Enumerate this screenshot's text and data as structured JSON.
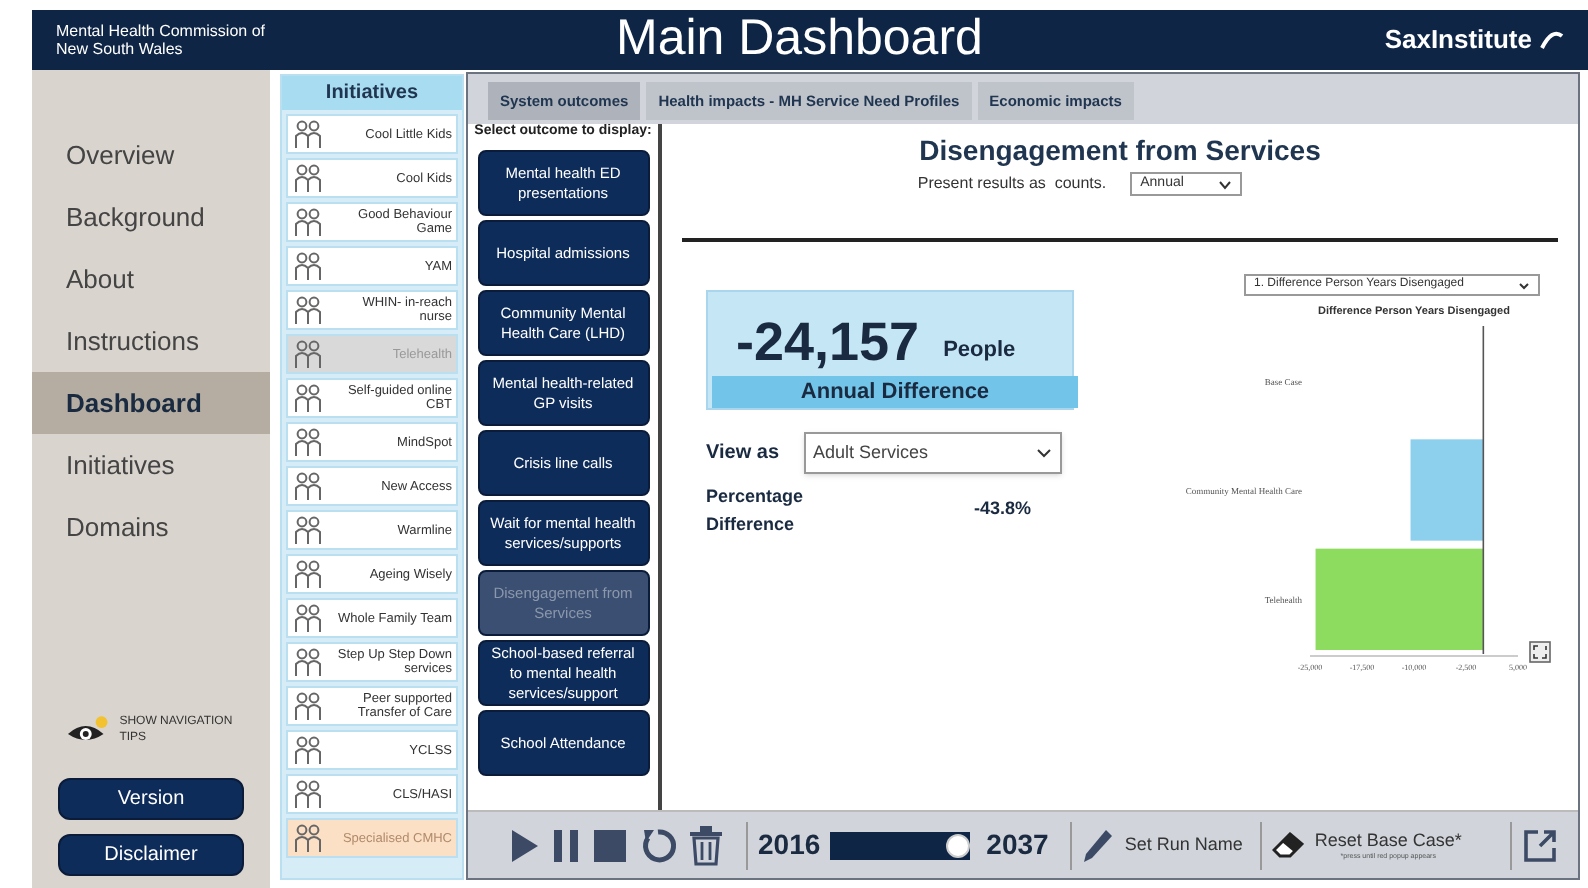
{
  "header": {
    "organisation": "Mental Health Commission of New South Wales",
    "title": "Main Dashboard",
    "logo": "SaxInstitute"
  },
  "navigation": {
    "items": [
      {
        "label": "Overview",
        "selected": false
      },
      {
        "label": "Background",
        "selected": false
      },
      {
        "label": "About",
        "selected": false
      },
      {
        "label": "Instructions",
        "selected": false
      },
      {
        "label": "Dashboard",
        "selected": true
      },
      {
        "label": "Initiatives",
        "selected": false
      },
      {
        "label": "Domains",
        "selected": false
      }
    ],
    "tips": "SHOW NAVIGATION TIPS",
    "buttons": [
      "Version",
      "Disclaimer"
    ]
  },
  "initiatives": {
    "title": "Initiatives",
    "items": [
      {
        "label": "Cool Little Kids",
        "selected": false,
        "flagged": false
      },
      {
        "label": "Cool Kids",
        "selected": false,
        "flagged": false
      },
      {
        "label": "Good Behaviour Game",
        "selected": false,
        "flagged": false
      },
      {
        "label": "YAM",
        "selected": false,
        "flagged": false
      },
      {
        "label": "WHIN- in-reach nurse",
        "selected": false,
        "flagged": false
      },
      {
        "label": "Telehealth",
        "selected": true,
        "flagged": false
      },
      {
        "label": "Self-guided online CBT",
        "selected": false,
        "flagged": false
      },
      {
        "label": "MindSpot",
        "selected": false,
        "flagged": false
      },
      {
        "label": "New Access",
        "selected": false,
        "flagged": false
      },
      {
        "label": "Warmline",
        "selected": false,
        "flagged": false
      },
      {
        "label": "Ageing Wisely",
        "selected": false,
        "flagged": false
      },
      {
        "label": "Whole Family Team",
        "selected": false,
        "flagged": false
      },
      {
        "label": "Step Up Step Down services",
        "selected": false,
        "flagged": false
      },
      {
        "label": "Peer supported Transfer of Care",
        "selected": false,
        "flagged": false
      },
      {
        "label": "YCLSS",
        "selected": false,
        "flagged": false
      },
      {
        "label": "CLS/HASI",
        "selected": false,
        "flagged": false
      },
      {
        "label": "Specialised CMHC",
        "selected": false,
        "flagged": true
      }
    ]
  },
  "tabs": [
    {
      "label": "System outcomes",
      "selected": true
    },
    {
      "label": "Health impacts - MH Service Need Profiles",
      "selected": false
    },
    {
      "label": "Economic impacts",
      "selected": false
    }
  ],
  "outcomes": {
    "prompt": "Select outcome to display:",
    "items": [
      {
        "label": "Mental health ED presentations",
        "selected": false
      },
      {
        "label": "Hospital admissions",
        "selected": false
      },
      {
        "label": "Community Mental Health Care (LHD)",
        "selected": false
      },
      {
        "label": "Mental health-related GP visits",
        "selected": false
      },
      {
        "label": "Crisis line calls",
        "selected": false
      },
      {
        "label": "Wait for mental health services/supports",
        "selected": false
      },
      {
        "label": "Disengagement from Services",
        "selected": true
      },
      {
        "label": "School-based referral to mental health services/support",
        "selected": false
      },
      {
        "label": "School Attendance",
        "selected": false
      }
    ]
  },
  "content": {
    "title": "Disengagement from Services",
    "present_label": "Present results as  counts.",
    "present_value": "Annual",
    "metric": {
      "value": "-24,157",
      "unit": "People",
      "caption": "Annual Difference"
    },
    "view_label": "View as",
    "view_value": "Adult Services",
    "percentage_label": "Percentage Difference",
    "percentage_value": "-43.8%",
    "chart_selector": "1. Difference Person Years Disengaged",
    "chart_data": {
      "type": "bar",
      "orientation": "horizontal",
      "title": "Difference Person Years Disengaged",
      "categories": [
        "Base Case",
        "Community Mental Health Care",
        "Telehealth"
      ],
      "stacked": true,
      "series": [
        {
          "color": "#8dd0ee",
          "values": [
            null,
            -10500,
            null
          ]
        },
        {
          "color": "#8ddc5f",
          "values": [
            null,
            null,
            -24200
          ]
        }
      ],
      "xlim": [
        -25000,
        5000
      ],
      "xticks": [
        {
          "value": -25000,
          "label": "-25,000"
        },
        {
          "value": -17500,
          "label": "-17,500"
        },
        {
          "value": -10000,
          "label": "-10,000"
        },
        {
          "value": -2500,
          "label": "-2,500"
        },
        {
          "value": 5000,
          "label": "5,000"
        }
      ]
    }
  },
  "toolbar": {
    "start_year": "2016",
    "end_year": "2037",
    "year_slider": {
      "level": 1
    },
    "run_name": "Set Run Name",
    "reset": "Reset Base Case*",
    "reset_note": "*press until red popup appears"
  }
}
